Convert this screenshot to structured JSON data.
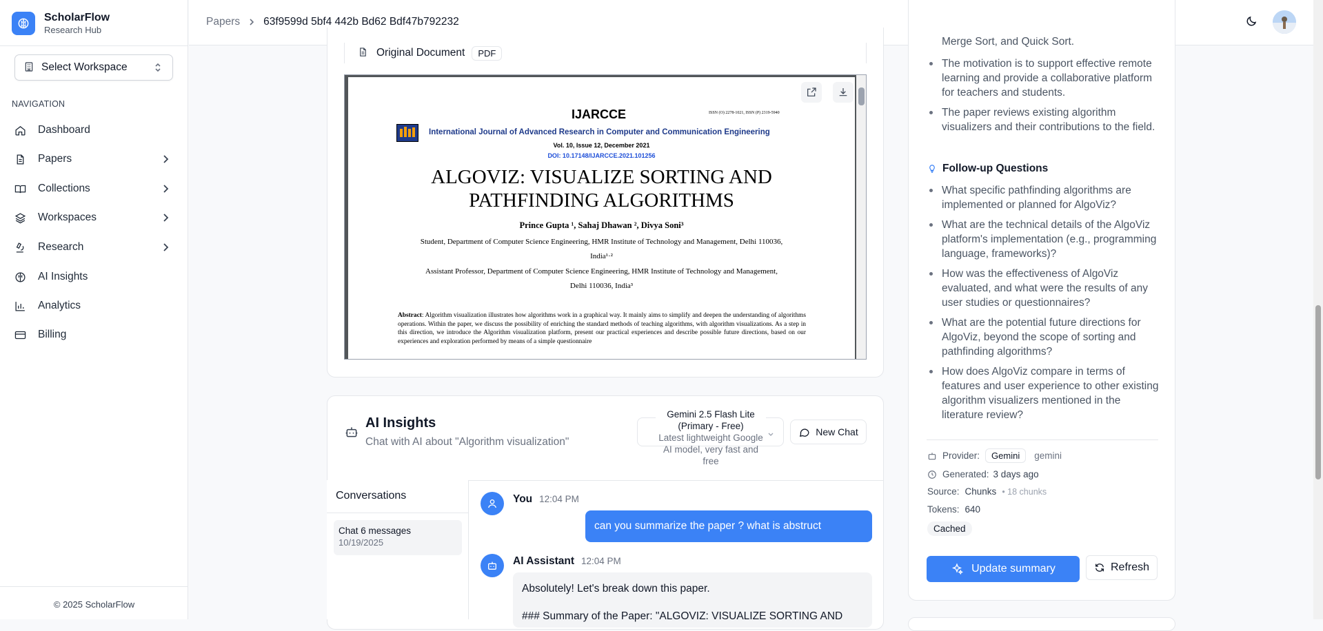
{
  "brand": {
    "name": "ScholarFlow",
    "subtitle": "Research Hub"
  },
  "workspace": {
    "label": "Select Workspace"
  },
  "nav": {
    "heading": "NAVIGATION",
    "items": [
      {
        "label": "Dashboard"
      },
      {
        "label": "Papers"
      },
      {
        "label": "Collections"
      },
      {
        "label": "Workspaces"
      },
      {
        "label": "Research"
      },
      {
        "label": "AI Insights"
      },
      {
        "label": "Analytics"
      },
      {
        "label": "Billing"
      }
    ]
  },
  "footer": "© 2025 ScholarFlow",
  "breadcrumb": {
    "root": "Papers",
    "current": "63f9599d 5bf4 442b Bd62 Bdf47b792232"
  },
  "document": {
    "label": "Original Document",
    "badge": "PDF",
    "pdf": {
      "journal": "IJARCCE",
      "issn": "ISSN (O) 2278-1021, ISSN (P) 2319-5940",
      "journal_full": "International Journal of Advanced Research in Computer and Communication Engineering",
      "volume": "Vol. 10, Issue 12, December 2021",
      "doi": "DOI:   10.17148/IJARCCE.2021.101256",
      "title1": "ALGOVIZ: VISUALIZE SORTING AND",
      "title2": "PATHFINDING ALGORITHMS",
      "authors": "Prince Gupta ¹, Sahaj Dhawan ², Divya Soni³",
      "aff1": "Student, Department of Computer Science Engineering, HMR Institute of Technology and Management, Delhi 110036,",
      "aff1b": "India¹·²",
      "aff2": "Assistant Professor, Department of Computer Science Engineering, HMR Institute of Technology and Management,",
      "aff2b": "Delhi 110036, India³",
      "abstract_label": "Abstract",
      "abstract": ": Algorithm visualization illustrates how algorithms work in a graphical way. It mainly aims to simplify and deepen the understanding of algorithms operations. Within the paper, we discuss the possibility of enriching the standard methods of teaching algorithms, with algorithm visualizations. As a step in this direction, we introduce the Algorithm visualization platform, present our practical experiences and describe possible future directions, based on our experiences and exploration performed by means of a simple questionnaire"
    }
  },
  "ai_insights": {
    "title": "AI Insights",
    "subtitle": "Chat with AI about \"Algorithm visualization\"",
    "model_name": "Gemini 2.5 Flash Lite (Primary - Free)",
    "model_desc": "Latest lightweight Google AI model, very fast and free",
    "new_chat": "New Chat",
    "conversations_title": "Conversations",
    "conversation": {
      "title": "Chat 6 messages",
      "date": "10/19/2025"
    },
    "messages": [
      {
        "sender": "You",
        "time": "12:04 PM",
        "text": "can you summarize the paper ? what is abstruct"
      },
      {
        "sender": "AI Assistant",
        "time": "12:04 PM",
        "text": "Absolutely! Let's break down this paper.",
        "text2": "### Summary of the Paper: \"ALGOVIZ: VISUALIZE SORTING AND"
      }
    ]
  },
  "summary_panel": {
    "clipped_text": "Merge Sort, and Quick Sort.",
    "bullets": [
      "The motivation is to support effective remote learning and provide a collaborative platform for teachers and students.",
      "The paper reviews existing algorithm visualizers and their contributions to the field."
    ],
    "followup_title": "Follow-up Questions",
    "followups": [
      "What specific pathfinding algorithms are implemented or planned for AlgoViz?",
      "What are the technical details of the AlgoViz platform's implementation (e.g., programming language, frameworks)?",
      "How was the effectiveness of AlgoViz evaluated, and what were the results of any user studies or questionnaires?",
      "What are the potential future directions for AlgoViz, beyond the scope of sorting and pathfinding algorithms?",
      "How does AlgoViz compare in terms of features and user experience to other existing algorithm visualizers mentioned in the literature review?"
    ],
    "meta": {
      "provider_label": "Provider:",
      "provider_badge": "Gemini",
      "provider_value": "gemini",
      "generated_label": "Generated:",
      "generated_value": "3 days ago",
      "source_label": "Source:",
      "source_value": "Chunks",
      "source_extra": "• 18 chunks",
      "tokens_label": "Tokens:",
      "tokens_value": "640",
      "cached": "Cached"
    },
    "update_button": "Update summary",
    "refresh_button": "Refresh"
  },
  "colors": {
    "accent": "#3b82f6",
    "border": "#e5e7eb",
    "muted": "#6b7280"
  }
}
